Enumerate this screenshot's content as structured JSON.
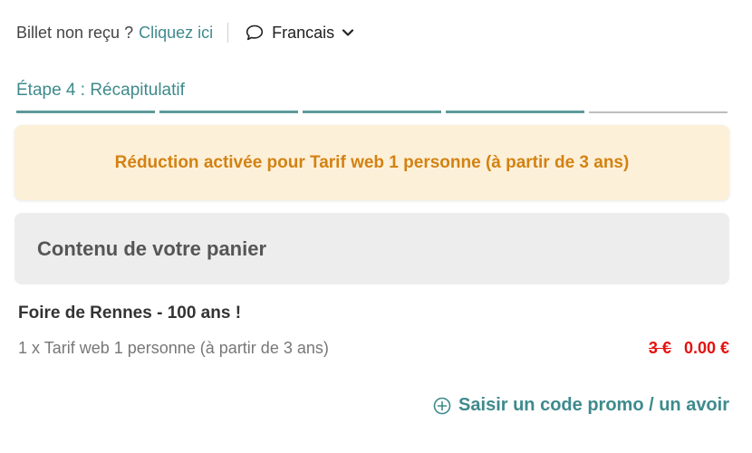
{
  "topbar": {
    "ticket_question": "Billet non reçu ?",
    "ticket_link": "Cliquez ici",
    "language": "Francais",
    "language_icon": "speech-bubble-icon",
    "dropdown_icon": "chevron-down-icon"
  },
  "step": {
    "title": "Étape 4 : Récapitulatif",
    "current": 4,
    "total": 5
  },
  "alert": {
    "message": "Réduction activée pour Tarif web 1 personne (à partir de 3 ans)"
  },
  "cart": {
    "heading": "Contenu de votre panier",
    "event_name": "Foire de Rennes - 100 ans !",
    "line_item": "1 x Tarif web 1 personne (à partir de 3 ans)",
    "old_price": "3 €",
    "new_price": "0.00 €"
  },
  "promo": {
    "label": "Saisir un code promo / un avoir",
    "icon": "plus-circle-icon"
  },
  "colors": {
    "accent": "#3f8a8c",
    "alert_bg": "#fdf0d9",
    "alert_text": "#d38212",
    "price_red": "#e3110f",
    "panel_bg": "#ededed"
  }
}
